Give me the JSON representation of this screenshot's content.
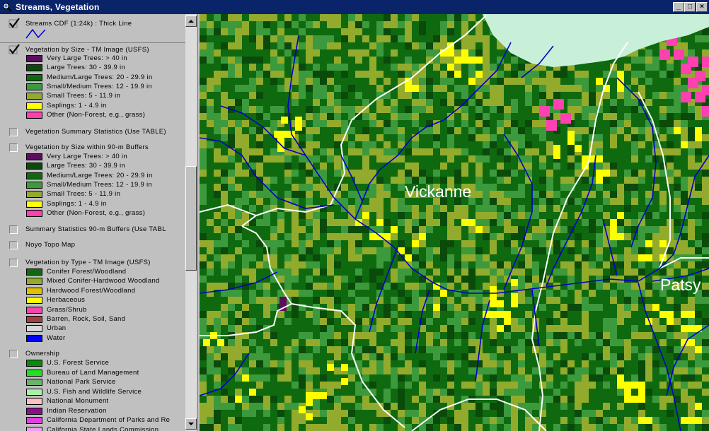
{
  "window": {
    "title": "Streams, Vegetation",
    "minimize": "_",
    "maximize": "□",
    "close": "×"
  },
  "colors": {
    "very_large": "#5e0c5e",
    "large": "#0a4a0a",
    "medium_large": "#0f6a0f",
    "small_medium": "#3c9a3c",
    "small": "#93ab2c",
    "saplings": "#ffff00",
    "other": "#ff40b0",
    "stream": "#0000c8",
    "road": "#ffffff",
    "water_body": "#c8f0d8"
  },
  "legend": {
    "streams": {
      "title": "Streams CDF (1:24k) : Thick Line",
      "checked": true
    },
    "veg_size": {
      "title": "Vegetation by Size - TM Image (USFS)",
      "checked": true,
      "items": [
        {
          "label": "Very Large Trees: > 40  in",
          "color": "#5e0c5e"
        },
        {
          "label": "Large Trees: 30 - 39.9 in",
          "color": "#0a4a0a"
        },
        {
          "label": "Medium/Large Trees: 20 - 29.9 in",
          "color": "#0f6a0f"
        },
        {
          "label": "Small/Medium Trees: 12 - 19.9 in",
          "color": "#3c9a3c"
        },
        {
          "label": "Small Trees: 5 - 11.9 in",
          "color": "#93ab2c"
        },
        {
          "label": "Saplings: 1 - 4.9 in",
          "color": "#ffff00"
        },
        {
          "label": "Other (Non-Forest, e.g., grass)",
          "color": "#ff40b0"
        }
      ]
    },
    "veg_summary": {
      "title": "Vegetation Summary Statistics (Use TABLE)",
      "checked": false
    },
    "veg_buffers": {
      "title": "Vegetation by Size within 90-m Buffers",
      "checked": false,
      "items": [
        {
          "label": "Very Large Trees: > 40  in",
          "color": "#5e0c5e"
        },
        {
          "label": "Large Trees: 30 - 39.9 in",
          "color": "#0a4a0a"
        },
        {
          "label": "Medium/Large Trees: 20 - 29.9 in",
          "color": "#0f6a0f"
        },
        {
          "label": "Small/Medium Trees: 12 - 19.9 in",
          "color": "#3c9a3c"
        },
        {
          "label": "Small Trees: 5 - 11.9 in",
          "color": "#93ab2c"
        },
        {
          "label": "Saplings: 1 - 4.9 in",
          "color": "#ffff00"
        },
        {
          "label": "Other (Non-Forest, e.g., grass)",
          "color": "#ff40b0"
        }
      ]
    },
    "summary_buffers": {
      "title": "Summary Statistics 90-m Buffers (Use TABL",
      "checked": false
    },
    "noyo_topo": {
      "title": "Noyo Topo Map",
      "checked": false
    },
    "veg_type": {
      "title": "Vegetation by Type - TM Image (USFS)",
      "checked": false,
      "items": [
        {
          "label": "Conifer Forest/Woodland",
          "color": "#0f6a0f"
        },
        {
          "label": "Mixed Conifer-Hardwood Woodland",
          "color": "#93ab2c"
        },
        {
          "label": "Hardwood Forest/Woodland",
          "color": "#e0c000"
        },
        {
          "label": "Herbaceous",
          "color": "#ffff00"
        },
        {
          "label": "Grass/Shrub",
          "color": "#ff40b0"
        },
        {
          "label": "Barren, Rock, Soil, Sand",
          "color": "#a04040"
        },
        {
          "label": "Urban",
          "color": "#d8d8d8"
        },
        {
          "label": "Water",
          "color": "#0000ff"
        }
      ]
    },
    "ownership": {
      "title": "Ownership",
      "checked": false,
      "items": [
        {
          "label": "U.S. Forest Service",
          "color": "#0a8a0a"
        },
        {
          "label": "Bureau of Land Management",
          "color": "#20e020"
        },
        {
          "label": "National Park Service",
          "color": "#6ab46a"
        },
        {
          "label": "U.S. Fish and Wildlife Service",
          "color": "#a8f0a8"
        },
        {
          "label": "National Monument",
          "color": "#ffc0c0"
        },
        {
          "label": "Indian Reservation",
          "color": "#8a108a"
        },
        {
          "label": "California Department of Parks and Re",
          "color": "#e040e0"
        },
        {
          "label": "California State Lands Commission",
          "color": "#f0a0f0"
        }
      ]
    }
  },
  "map": {
    "labels": [
      {
        "text": "Vickanne"
      },
      {
        "text": "Patsy"
      }
    ]
  }
}
